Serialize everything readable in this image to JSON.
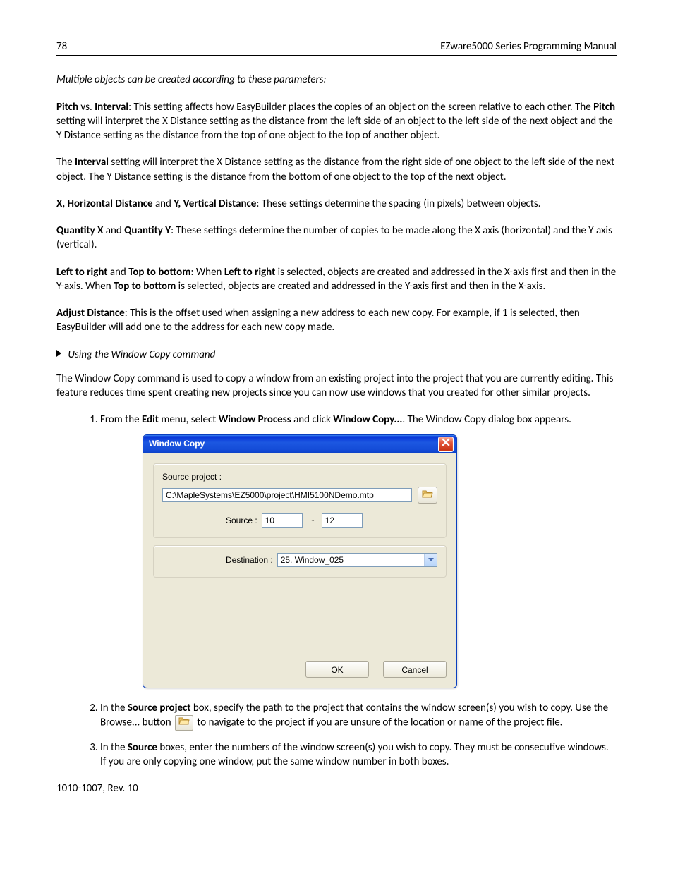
{
  "header": {
    "page_number": "78",
    "title": "EZware5000 Series Programming Manual"
  },
  "intro": "Multiple objects can be created according to these parameters:",
  "p1": {
    "b1": "Pitch",
    "t1": " vs. ",
    "b2": "Interval",
    "t2": ": This setting affects how EasyBuilder places the copies of an object on the screen relative to each other. The ",
    "b3": "Pitch",
    "t3": " setting will interpret the X Distance setting as the distance from the left side of an object to the left side of the next object and the Y Distance setting as the distance from the top of one object to the top of another object."
  },
  "p2": {
    "t1": "The ",
    "b1": "Interval",
    "t2": " setting will interpret the X Distance setting as the distance from the right side of one object to the left side of the next object. The Y Distance setting is the distance from the bottom of one object to the top of the next object."
  },
  "p3": {
    "b1": "X, Horizontal Distance",
    "t1": " and ",
    "b2": "Y, Vertical Distance",
    "t2": ": These settings determine the spacing (in pixels) between objects."
  },
  "p4": {
    "b1": "Quantity X",
    "t1": " and ",
    "b2": "Quantity Y",
    "t2": ": These settings determine the number of copies to be made along the X axis (horizontal) and the Y axis (vertical)."
  },
  "p5": {
    "b1": "Left to right",
    "t1": " and ",
    "b2": "Top to bottom",
    "t2": ": When ",
    "b3": "Left to right",
    "t3": " is selected, objects are created and addressed in the X-axis first and then in the Y-axis. When ",
    "b4": "Top to bottom",
    "t4": " is selected, objects are created and addressed in the Y-axis first and then in the X-axis."
  },
  "p6": {
    "b1": "Adjust Distance",
    "t1": ": This is the offset used when assigning a new address to each new copy. For example, if 1 is selected, then EasyBuilder will add one to the address for each new copy made."
  },
  "subhead": "Using the Window Copy command",
  "p7": "The Window Copy command is used to copy a window from an existing project into the project that you are currently editing. This feature reduces time spent creating new projects since you can now use windows that you created for other similar projects.",
  "list": {
    "i1": {
      "t1": "From the ",
      "b1": "Edit",
      "t2": " menu, select ",
      "b2": "Window Process",
      "t3": " and click ",
      "b3": "Window Copy...",
      "t4": ". The Window Copy dialog box appears."
    },
    "i2": {
      "t1": "In the ",
      "b1": "Source project",
      "t2": " box, specify the path to the project that contains the window screen(s) you wish to copy. Use the Browse... button ",
      "t3": " to navigate to the project if you are unsure of the location or name of the project file."
    },
    "i3": {
      "t1": "In the ",
      "b1": "Source",
      "t2": " boxes, enter the numbers of the window screen(s) you wish to copy. They must be consecutive windows. If you are only copying one window, put the same window number in both boxes."
    }
  },
  "dialog": {
    "title": "Window Copy",
    "source_project_label": "Source project :",
    "source_project_path": "C:\\MapleSystems\\EZ5000\\project\\HMI5100NDemo.mtp",
    "source_label": "Source :",
    "source_from": "10",
    "tilde": "~",
    "source_to": "12",
    "destination_label": "Destination :",
    "destination_value": "25. Window_025",
    "ok": "OK",
    "cancel": "Cancel"
  },
  "footer": "1010-1007, Rev. 10"
}
